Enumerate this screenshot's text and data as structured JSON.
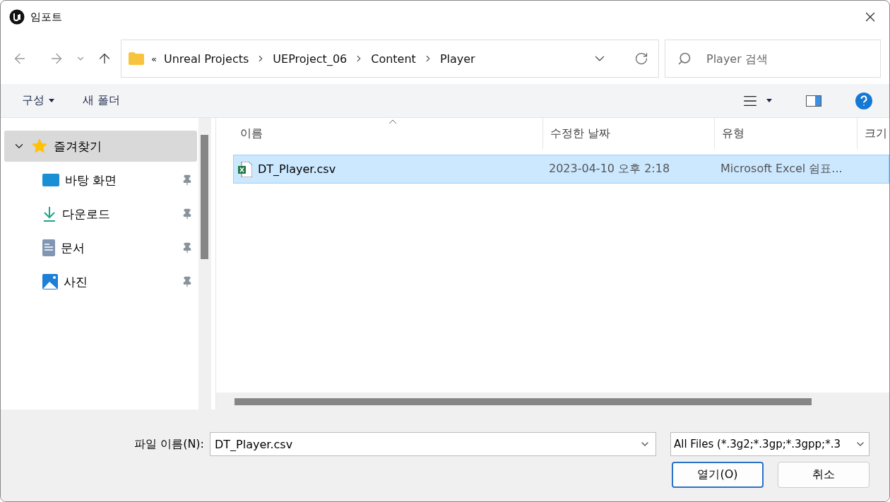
{
  "window": {
    "title": "임포트"
  },
  "address": {
    "overflow": "«",
    "segments": [
      "Unreal Projects",
      "UEProject_06",
      "Content",
      "Player"
    ]
  },
  "search": {
    "placeholder": "Player 검색"
  },
  "toolbar": {
    "organize": "구성",
    "new_folder": "새 폴더"
  },
  "sidebar": {
    "items": [
      {
        "label": "즐겨찾기",
        "kind": "group",
        "expanded": true,
        "selected": true,
        "children": [
          {
            "label": "바탕 화면",
            "kind": "desktop",
            "pinned": true,
            "selected": false
          },
          {
            "label": "다운로드",
            "kind": "download",
            "pinned": true,
            "selected": false
          },
          {
            "label": "문서",
            "kind": "documents",
            "pinned": true,
            "selected": false
          },
          {
            "label": "사진",
            "kind": "pictures",
            "pinned": true,
            "selected": false
          }
        ]
      }
    ]
  },
  "table": {
    "columns": [
      "이름",
      "수정한 날짜",
      "유형",
      "크기"
    ],
    "rows": [
      {
        "name": "DT_Player.csv",
        "modified": "2023-04-10 오후 2:18",
        "type": "Microsoft Excel 쉼표...",
        "selected": true
      }
    ]
  },
  "footer": {
    "filename_label": "파일 이름(N):",
    "filename": "DT_Player.csv",
    "filter": "All Files (*.3g2;*.3gp;*.3gpp;*.3",
    "open": "열기(O)",
    "cancel": "취소"
  }
}
